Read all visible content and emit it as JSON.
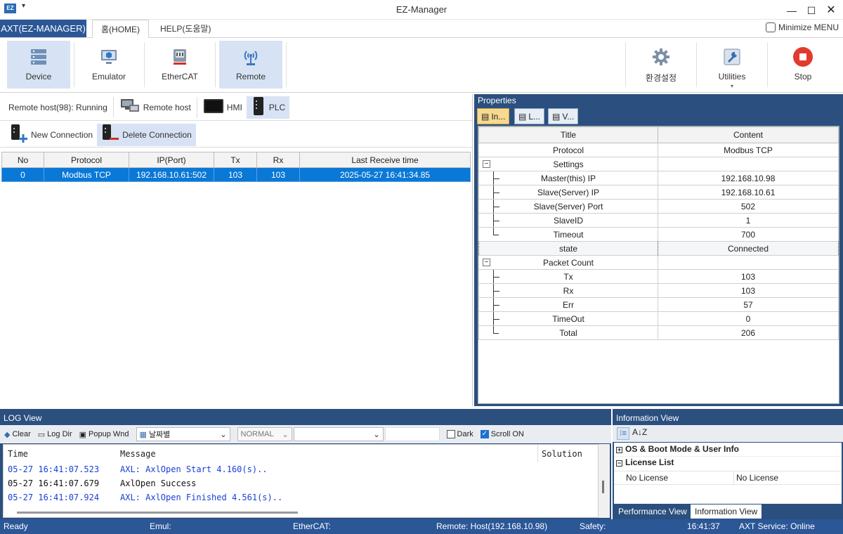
{
  "app": {
    "icon_text": "EZ",
    "title": "EZ-Manager",
    "app_menu": "AXT(EZ-MANAGER)",
    "tabs": [
      "홈(HOME)",
      "HELP(도움말)"
    ],
    "minimize_menu": "Minimize MENU"
  },
  "ribbon": {
    "left": [
      "Device",
      "Emulator",
      "EtherCAT",
      "Remote"
    ],
    "right": [
      "환경설정",
      "Utilities",
      "Stop"
    ]
  },
  "host_bar": {
    "status": "Remote host(98): Running",
    "remote_host": "Remote host",
    "hmi": "HMI",
    "plc": "PLC"
  },
  "conn_bar": {
    "new": "New Connection",
    "delete": "Delete Connection"
  },
  "connections": {
    "columns": [
      "No",
      "Protocol",
      "IP(Port)",
      "Tx",
      "Rx",
      "Last Receive time"
    ],
    "rows": [
      [
        "0",
        "Modbus TCP",
        "192.168.10.61:502",
        "103",
        "103",
        "2025-05-27 16:41:34.85"
      ]
    ]
  },
  "properties": {
    "title": "Properties",
    "tabs": [
      "In...",
      "L...",
      "V..."
    ],
    "columns": [
      "Title",
      "Content"
    ],
    "rows": [
      {
        "title": "Protocol",
        "content": "Modbus TCP",
        "kind": "plain"
      },
      {
        "title": "Settings",
        "content": "",
        "kind": "group"
      },
      {
        "title": "Master(this) IP",
        "content": "192.168.10.98",
        "kind": "child"
      },
      {
        "title": "Slave(Server) IP",
        "content": "192.168.10.61",
        "kind": "child"
      },
      {
        "title": "Slave(Server) Port",
        "content": "502",
        "kind": "child"
      },
      {
        "title": "SlaveID",
        "content": "1",
        "kind": "child"
      },
      {
        "title": "Timeout",
        "content": "700",
        "kind": "last"
      },
      {
        "title": "state",
        "content": "Connected",
        "kind": "focus"
      },
      {
        "title": "Packet Count",
        "content": "",
        "kind": "group"
      },
      {
        "title": "Tx",
        "content": "103",
        "kind": "child"
      },
      {
        "title": "Rx",
        "content": "103",
        "kind": "child"
      },
      {
        "title": "Err",
        "content": "57",
        "kind": "child"
      },
      {
        "title": "TimeOut",
        "content": "0",
        "kind": "child"
      },
      {
        "title": "Total",
        "content": "206",
        "kind": "last"
      }
    ]
  },
  "log": {
    "title": "LOG View",
    "clear": "Clear",
    "log_dir": "Log Dir",
    "popup": "Popup Wnd",
    "date": "날짜별",
    "level": "NORMAL",
    "dark": "Dark",
    "scroll": "Scroll ON",
    "headers": [
      "Time",
      "Message",
      "Solution"
    ],
    "lines": [
      {
        "time": "05-27 16:41:07.523",
        "msg": "AXL: AxlOpen Start 4.160(s)..",
        "color": "#1a3fd6"
      },
      {
        "time": "05-27 16:41:07.679",
        "msg": "AxlOpen Success",
        "color": "#111111"
      },
      {
        "time": "05-27 16:41:07.924",
        "msg": "AXL: AxlOpen Finished 4.561(s)..",
        "color": "#1a3fd6"
      }
    ]
  },
  "info": {
    "title": "Information View",
    "os": "OS & Boot Mode & User Info",
    "license": "License List",
    "no_license_a": "No License",
    "no_license_b": "No License",
    "tabs": [
      "Performance View",
      "Information View"
    ]
  },
  "status": {
    "ready": "Ready",
    "emul": "Emul:",
    "ethercat": "EtherCAT:",
    "remote": "Remote: Host(192.168.10.98)",
    "safety": "Safety:",
    "time": "16:41:37",
    "service": "AXT Service: Online"
  }
}
